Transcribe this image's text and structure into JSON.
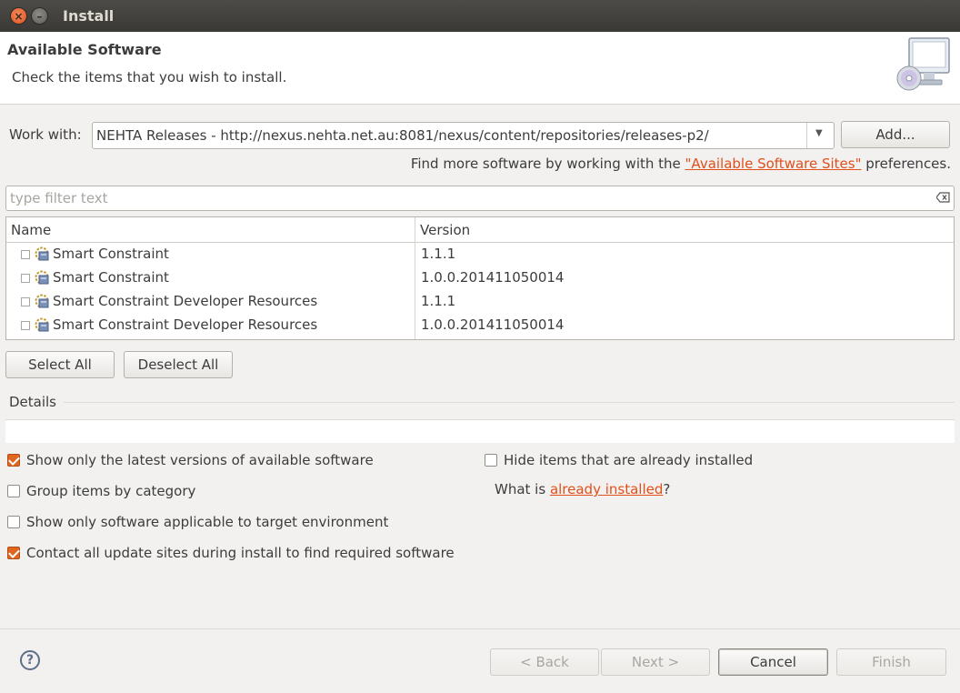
{
  "window": {
    "title": "Install"
  },
  "header": {
    "title": "Available Software",
    "subtitle": "Check the items that you wish to install.",
    "icon": "install-monitor-cd-icon"
  },
  "work_with": {
    "label": "Work with:",
    "value": "NEHTA Releases - http://nexus.nehta.net.au:8081/nexus/content/repositories/releases-p2/",
    "add_button": "Add...",
    "hint_prefix": "Find more software by working with the ",
    "hint_link": "\"Available Software Sites\"",
    "hint_suffix": " preferences."
  },
  "filter": {
    "placeholder": "type filter text"
  },
  "table": {
    "columns": [
      "Name",
      "Version"
    ],
    "rows": [
      {
        "name": "Smart Constraint",
        "version": "1.1.1"
      },
      {
        "name": "Smart Constraint",
        "version": "1.0.0.201411050014"
      },
      {
        "name": "Smart Constraint Developer Resources",
        "version": "1.1.1"
      },
      {
        "name": "Smart Constraint Developer Resources",
        "version": "1.0.0.201411050014"
      }
    ]
  },
  "selection": {
    "select_all": "Select All",
    "deselect_all": "Deselect All"
  },
  "details": {
    "label": "Details"
  },
  "options": {
    "latest_versions": {
      "label": "Show only the latest versions of available software",
      "checked": true
    },
    "group_by_category": {
      "label": "Group items by category",
      "checked": false
    },
    "target_env": {
      "label": "Show only software applicable to target environment",
      "checked": false
    },
    "contact_sites": {
      "label": "Contact all update sites during install to find required software",
      "checked": true
    },
    "hide_installed": {
      "label": "Hide items that are already installed",
      "checked": false
    },
    "what_is_prefix": "What is ",
    "what_is_link": "already installed",
    "what_is_suffix": "?"
  },
  "footer": {
    "back": "< Back",
    "next": "Next >",
    "cancel": "Cancel",
    "finish": "Finish"
  },
  "colors": {
    "accent": "#e0501b",
    "titlebar": "#3c3b37"
  }
}
